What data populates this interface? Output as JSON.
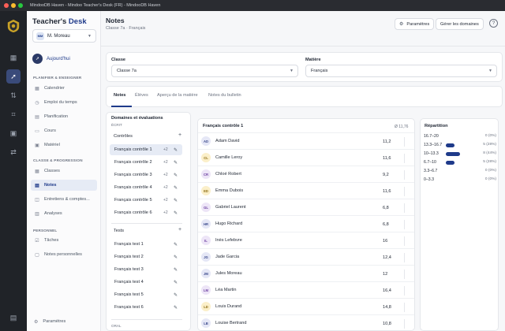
{
  "window": {
    "title": "MindooDB Haven - Mindoo Teacher's Desk (FR) - MindooDB Haven"
  },
  "rail": {
    "icons": [
      "dashboard-icon",
      "rocket-icon",
      "swap-icon",
      "scan-icon",
      "calendar-icon",
      "transfer-icon"
    ],
    "active": 1
  },
  "sidebar": {
    "brand_a": "Teacher's",
    "brand_b": "Desk",
    "user_initials": "MM",
    "user_name": "M. Moreau",
    "today": "Aujourd'hui",
    "sections": {
      "plan": "PLANIFIER & ENSEIGNER",
      "classe": "CLASSE & PROGRESSION",
      "perso": "PERSONNEL"
    },
    "plan_items": [
      {
        "label": "Calendrier",
        "icon": "▦"
      },
      {
        "label": "Emploi du temps",
        "icon": "◷"
      },
      {
        "label": "Planification",
        "icon": "▤"
      },
      {
        "label": "Cours",
        "icon": "▭"
      },
      {
        "label": "Matériel",
        "icon": "▣"
      }
    ],
    "classe_items": [
      {
        "label": "Classes",
        "icon": "▦"
      },
      {
        "label": "Notes",
        "icon": "▤"
      },
      {
        "label": "Entretiens & comptes...",
        "icon": "◫"
      },
      {
        "label": "Analyses",
        "icon": "▥"
      }
    ],
    "perso_items": [
      {
        "label": "Tâches",
        "icon": "☑"
      },
      {
        "label": "Notes personnelles",
        "icon": "▢"
      }
    ],
    "settings": "Paramètres"
  },
  "header": {
    "title": "Notes",
    "breadcrumb": "Classe 7a · Français",
    "settings_label": "Paramètres",
    "manage_label": "Gérer les domaines",
    "help": "?"
  },
  "filters": {
    "class_label": "Classe",
    "class_value": "Classe 7a",
    "subject_label": "Matière",
    "subject_value": "Français"
  },
  "tabs": [
    "Notes",
    "Élèves",
    "Aperçu de la matière",
    "Notes du bulletin"
  ],
  "domains": {
    "title": "Domaines et évaluations",
    "written": "ÉCRIT",
    "controles_title": "Contrôles",
    "controles": [
      {
        "label": "Français contrôle 1",
        "count": "+2"
      },
      {
        "label": "Français contrôle 2",
        "count": "+2"
      },
      {
        "label": "Français contrôle 3",
        "count": "+2"
      },
      {
        "label": "Français contrôle 4",
        "count": "+2"
      },
      {
        "label": "Français contrôle 5",
        "count": "+2"
      },
      {
        "label": "Français contrôle 6",
        "count": "+2"
      }
    ],
    "tests_title": "Tests",
    "tests": [
      {
        "label": "Français test 1"
      },
      {
        "label": "Français test 2"
      },
      {
        "label": "Français test 3"
      },
      {
        "label": "Français test 4"
      },
      {
        "label": "Français test 5"
      },
      {
        "label": "Français test 6"
      }
    ],
    "oral": "ORAL"
  },
  "grades": {
    "title": "Français contrôle 1",
    "average": "Ø 11,76",
    "students": [
      {
        "initials": "AD",
        "name": "Adam David",
        "grade": "11,2",
        "color": "#e5e7f6",
        "fg": "#3b4a8c"
      },
      {
        "initials": "CL",
        "name": "Camille Leroy",
        "grade": "11,6",
        "color": "#fbefc9",
        "fg": "#8a6a10"
      },
      {
        "initials": "CR",
        "name": "Chloé Robert",
        "grade": "9,2",
        "color": "#ede5f7",
        "fg": "#6b3fa0"
      },
      {
        "initials": "ED",
        "name": "Emma Dubois",
        "grade": "11,6",
        "color": "#fbefc9",
        "fg": "#8a6a10"
      },
      {
        "initials": "GL",
        "name": "Gabriel Laurent",
        "grade": "6,8",
        "color": "#ede5f7",
        "fg": "#6b3fa0"
      },
      {
        "initials": "HR",
        "name": "Hugo Richard",
        "grade": "6,8",
        "color": "#e5e7f6",
        "fg": "#3b4a8c"
      },
      {
        "initials": "IL",
        "name": "Inès Lefebvre",
        "grade": "16",
        "color": "#ede5f7",
        "fg": "#6b3fa0"
      },
      {
        "initials": "JG",
        "name": "Jade Garcia",
        "grade": "12,4",
        "color": "#e5e7f6",
        "fg": "#3b4a8c"
      },
      {
        "initials": "JM",
        "name": "Jules Moreau",
        "grade": "12",
        "color": "#e5e7f6",
        "fg": "#3b4a8c"
      },
      {
        "initials": "LM",
        "name": "Léa Martin",
        "grade": "16,4",
        "color": "#ede5f7",
        "fg": "#6b3fa0"
      },
      {
        "initials": "LD",
        "name": "Louis Durand",
        "grade": "14,8",
        "color": "#fbefc9",
        "fg": "#8a6a10"
      },
      {
        "initials": "LB",
        "name": "Louise Bertrand",
        "grade": "10,8",
        "color": "#e5e7f6",
        "fg": "#3b4a8c"
      },
      {
        "initials": "LB",
        "name": "Lucas Bernard",
        "grade": "13,2",
        "color": "#fbefc9",
        "fg": "#8a6a10"
      }
    ]
  },
  "distribution": {
    "title": "Répartition",
    "rows": [
      {
        "label": "16.7–20",
        "fraction": 0,
        "text": "0 (0%)"
      },
      {
        "label": "13.3–16.7",
        "fraction": 0.28,
        "text": "5 (28%)"
      },
      {
        "label": "10–13.3",
        "fraction": 0.44,
        "text": "8 (44%)"
      },
      {
        "label": "6.7–10",
        "fraction": 0.28,
        "text": "5 (28%)"
      },
      {
        "label": "3.3–6.7",
        "fraction": 0,
        "text": "0 (0%)"
      },
      {
        "label": "0–3.3",
        "fraction": 0,
        "text": "0 (0%)"
      }
    ]
  },
  "colors": {
    "accent": "#1e3a8a",
    "rail": "#202328"
  }
}
